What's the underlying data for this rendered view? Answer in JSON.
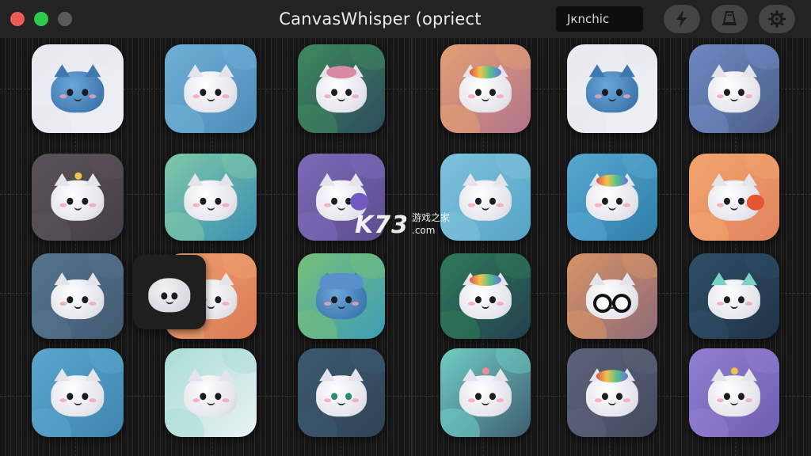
{
  "window": {
    "title": "CanvasWhisper (opriect",
    "traffic_lights": [
      {
        "name": "close",
        "color": "#ee5d55"
      },
      {
        "name": "minimize",
        "color": "#2ec84a"
      },
      {
        "name": "maximize",
        "color": "#5a5a5a"
      }
    ]
  },
  "toolbar": {
    "search_value": "Jкnchic",
    "buttons": [
      {
        "icon": "lightning-icon"
      },
      {
        "icon": "bell-icon"
      },
      {
        "icon": "gear-icon"
      }
    ]
  },
  "watermark": {
    "main": "K73",
    "chinese": "游戏之家",
    "domain": ".com"
  },
  "grid": {
    "rows": [
      [
        {
          "bg": "#eef0f3",
          "accent": "#e7e9ee",
          "face": "blue",
          "style": "plain"
        },
        {
          "bg": "#4e8bb6",
          "accent": "#6fb0d6",
          "face": "white",
          "style": "plain"
        },
        {
          "bg": "#2d4b5d",
          "accent": "#3e8a5c",
          "face": "white",
          "style": "headband"
        },
        {
          "bg": "#b0748c",
          "accent": "#e3a073",
          "face": "white",
          "style": "rainbow"
        },
        {
          "bg": "#eef0f3",
          "accent": "#e7e9ee",
          "face": "blue",
          "style": "plain"
        },
        {
          "bg": "#4a5d86",
          "accent": "#6f8ac3",
          "face": "white",
          "style": "plain"
        }
      ],
      [
        {
          "bg": "#453f45",
          "accent": "#5b5357",
          "face": "white",
          "style": "unicorn"
        },
        {
          "bg": "#3a8fb2",
          "accent": "#7fc9a8",
          "face": "white",
          "style": "plain"
        },
        {
          "bg": "#5a4d8c",
          "accent": "#7d6bb8",
          "face": "white",
          "style": "purple-patch"
        },
        {
          "bg": "#55a3c6",
          "accent": "#7ec3dc",
          "face": "white",
          "style": "plain"
        },
        {
          "bg": "#2f7ea8",
          "accent": "#56a8cf",
          "face": "white",
          "style": "colorful"
        },
        {
          "bg": "#e08360",
          "accent": "#f2a56d",
          "face": "white",
          "style": "horns"
        }
      ],
      [
        {
          "bg": "#415a70",
          "accent": "#56748f",
          "face": "white",
          "style": "plain"
        },
        {
          "bg": "#d97a55",
          "accent": "#f0a170",
          "face": "white",
          "style": "overlap"
        },
        {
          "bg": "#3d9cb5",
          "accent": "#76c07a",
          "face": "blue",
          "style": "hat"
        },
        {
          "bg": "#23404f",
          "accent": "#2e7b58",
          "face": "white",
          "style": "colorful"
        },
        {
          "bg": "#8f6a78",
          "accent": "#d79466",
          "face": "white",
          "style": "bigeyes"
        },
        {
          "bg": "#1f3448",
          "accent": "#2f4e66",
          "face": "white",
          "style": "teal-ears"
        }
      ],
      [
        {
          "bg": "#3e85ad",
          "accent": "#5aa6cc",
          "face": "white",
          "style": "plain"
        },
        {
          "bg": "#eaf3f3",
          "accent": "#a8dcd7",
          "face": "white",
          "style": "plain"
        },
        {
          "bg": "#2e4356",
          "accent": "#3d5a70",
          "face": "white",
          "style": "green-eyes"
        },
        {
          "bg": "#3f5d70",
          "accent": "#6fcfc4",
          "face": "white",
          "style": "flower"
        },
        {
          "bg": "#444a5e",
          "accent": "#5c6378",
          "face": "white",
          "style": "colorful"
        },
        {
          "bg": "#6e5fb0",
          "accent": "#8f7fd0",
          "face": "white",
          "style": "unicorn"
        }
      ]
    ]
  }
}
